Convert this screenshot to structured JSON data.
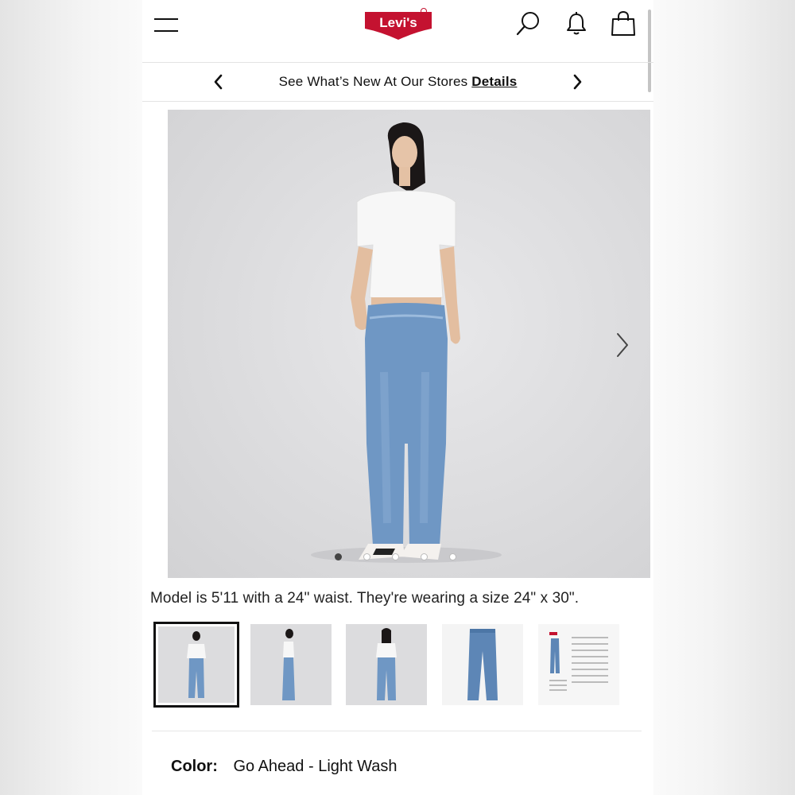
{
  "header": {
    "brand": "Levi's",
    "icons": [
      "menu-icon",
      "search-icon",
      "bell-icon",
      "shopping-bag-icon"
    ]
  },
  "promo": {
    "text": "See What’s New At Our Stores",
    "link": "Details"
  },
  "gallery": {
    "image_count": 5,
    "active_index": 0,
    "model_note": "Model is 5'11 with a 24\" waist. They're wearing a size 24\" x 30\".",
    "thumbnails": [
      "front-view",
      "side-view",
      "back-view",
      "flat-lay",
      "size-chart"
    ]
  },
  "product": {
    "color_label": "Color:",
    "color_value": "Go Ahead - Light Wash"
  },
  "colors": {
    "brand_red": "#c41230",
    "denim": "#6f97c4",
    "text": "#111111"
  }
}
